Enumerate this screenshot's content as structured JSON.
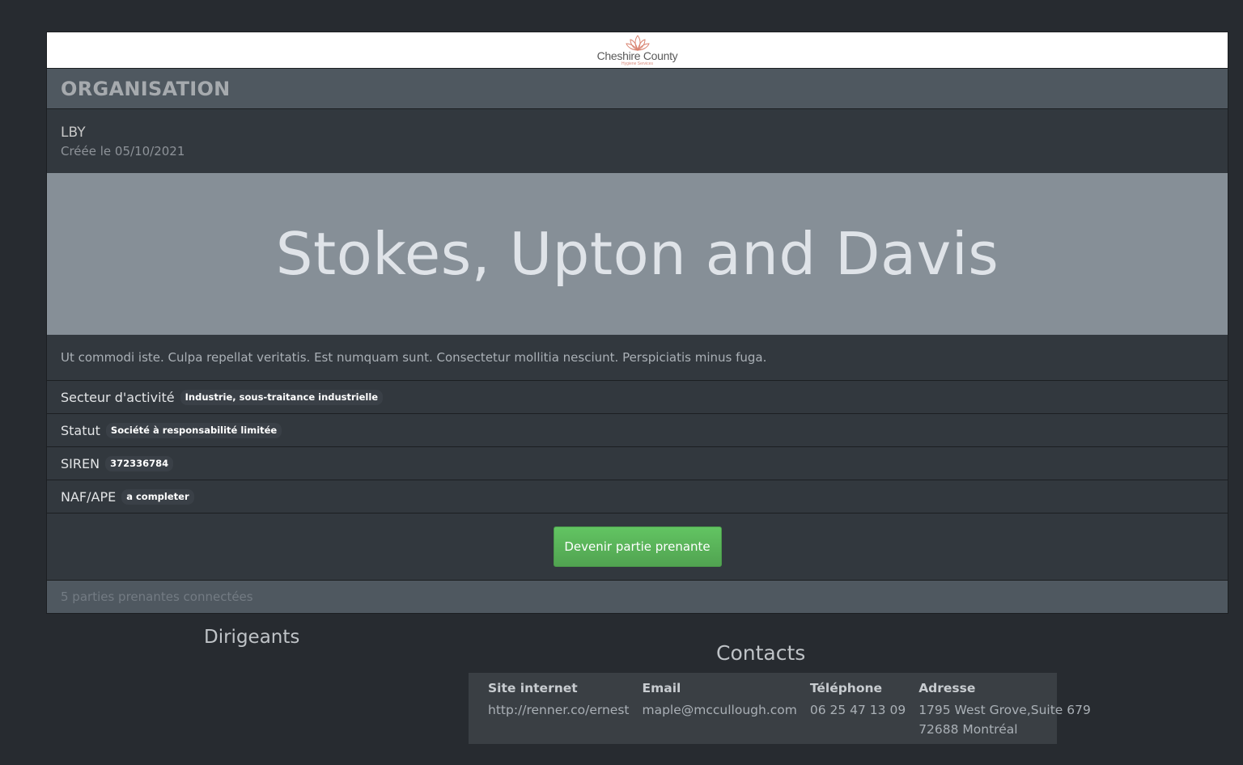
{
  "logo": {
    "name": "Cheshire County",
    "tagline": "Hygiene Services"
  },
  "card": {
    "header": "ORGANISATION",
    "acronym": "LBY",
    "created": "Créée le 05/10/2021",
    "name": "Stokes, Upton and Davis",
    "description": "Ut commodi iste. Culpa repellat veritatis. Est numquam sunt. Consectetur mollitia nesciunt. Perspiciatis minus fuga.",
    "info_rows": [
      {
        "label": "Secteur d'activité",
        "value": "Industrie, sous-traitance industrielle"
      },
      {
        "label": "Statut",
        "value": "Société à responsabilité limitée"
      },
      {
        "label": "SIREN",
        "value": "372336784"
      },
      {
        "label": "NAF/APE",
        "value": "a completer"
      }
    ],
    "action_button": "Devenir partie prenante",
    "footer": "5 parties prenantes connectées"
  },
  "dirigeants": {
    "title": "Dirigeants"
  },
  "contacts": {
    "title": "Contacts",
    "headers": [
      "Site internet",
      "Email",
      "Téléphone",
      "Adresse"
    ],
    "website": "http://renner.co/ernest",
    "email": "maple@mccullough.com",
    "phone": "06 25 47 13 09",
    "address_line1": "1795 West Grove,Suite 679",
    "address_line2": "72688 Montréal"
  },
  "colors": {
    "background": "#272b30",
    "card": "#32383e",
    "header": "#4f5860",
    "banner": "#868f97",
    "success": "#5ab95e"
  }
}
